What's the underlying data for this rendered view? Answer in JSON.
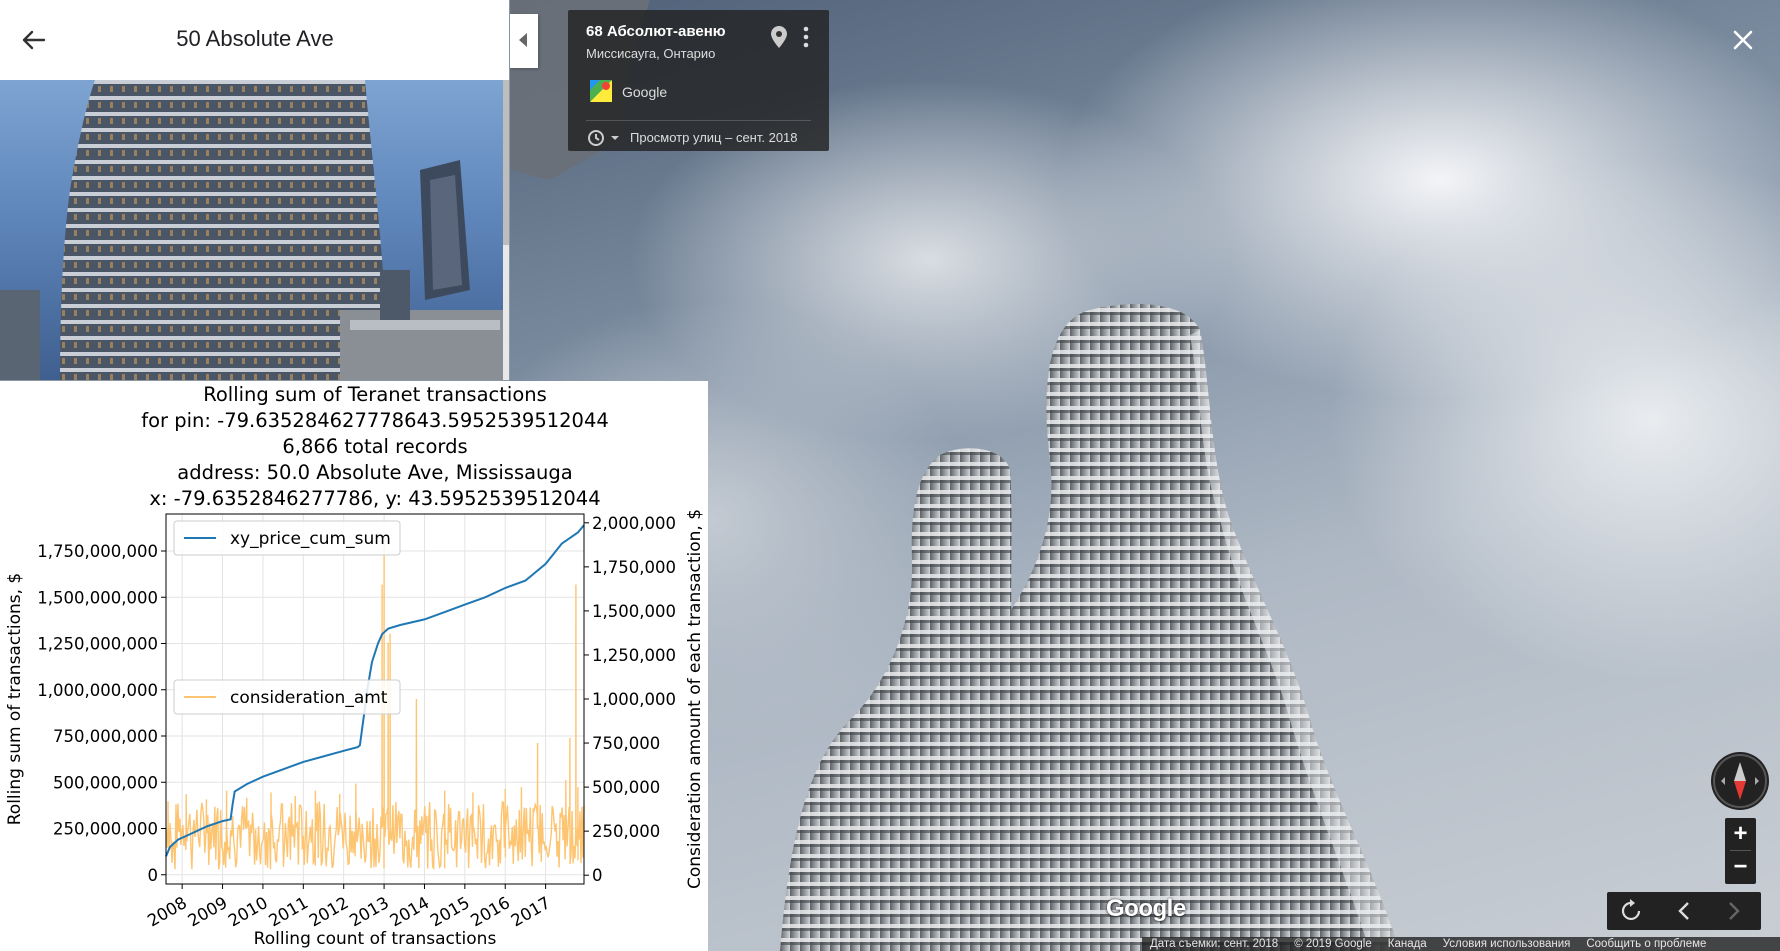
{
  "panel": {
    "title": "50 Absolute Ave"
  },
  "info_card": {
    "title": "68 Абсолют-авеню",
    "subtitle": "Миссисауга, Онтарио",
    "source": "Google",
    "date": "Просмотр улиц – сент. 2018"
  },
  "street_view": {
    "logo": "Google",
    "zoom_in": "+",
    "zoom_out": "−",
    "icons": [
      "back-arrow-icon",
      "pin-icon",
      "more-vert-icon",
      "close-icon",
      "history-icon",
      "compass-icon",
      "rotate-icon",
      "chevron-left-icon",
      "chevron-right-icon"
    ]
  },
  "footer": {
    "capture_date": "Дата съемки: сент. 2018",
    "copyright": "© 2019 Google",
    "country": "Канада",
    "terms": "Условия использования",
    "report": "Сообщить о проблеме"
  },
  "chart_data": {
    "type": "line",
    "title_lines": [
      "Rolling sum of Teranet transactions",
      "for pin: -79.635284627778643.5952539512044",
      "6,866 total records",
      "address: 50.0 Absolute Ave, Mississauga",
      "x: -79.6352846277786, y: 43.5952539512044"
    ],
    "xlabel": "Rolling count of transactions",
    "ylabel_left": "Rolling sum of transactions, $",
    "ylabel_right": "Consideration amount of each transaction, $",
    "x_tick_labels": [
      "2008",
      "2009",
      "2010",
      "2011",
      "2012",
      "2013",
      "2014",
      "2015",
      "2016",
      "2017"
    ],
    "x_range": [
      2007.6,
      2017.95
    ],
    "y_left_ticks": [
      "0",
      "250,000,000",
      "500,000,000",
      "750,000,000",
      "1,000,000,000",
      "1,250,000,000",
      "1,500,000,000",
      "1,750,000,000"
    ],
    "y_left_range": [
      -50000000,
      1950000000
    ],
    "y_right_ticks": [
      "0",
      "250,000",
      "500,000",
      "750,000",
      "1,000,000",
      "1,250,000",
      "1,500,000",
      "1,750,000",
      "2,000,000"
    ],
    "y_right_range": [
      -50000,
      2050000
    ],
    "grid": true,
    "series": [
      {
        "name": "xy_price_cum_sum",
        "axis": "left",
        "color": "#1f77b4",
        "legend_position": "upper-left",
        "points": [
          [
            2007.6,
            100000000
          ],
          [
            2007.7,
            150000000
          ],
          [
            2007.9,
            190000000
          ],
          [
            2008.2,
            220000000
          ],
          [
            2008.6,
            260000000
          ],
          [
            2009.0,
            290000000
          ],
          [
            2009.2,
            300000000
          ],
          [
            2009.25,
            380000000
          ],
          [
            2009.3,
            450000000
          ],
          [
            2009.6,
            490000000
          ],
          [
            2010.0,
            530000000
          ],
          [
            2010.5,
            570000000
          ],
          [
            2011.0,
            610000000
          ],
          [
            2011.5,
            640000000
          ],
          [
            2012.0,
            670000000
          ],
          [
            2012.35,
            690000000
          ],
          [
            2012.4,
            700000000
          ],
          [
            2012.5,
            860000000
          ],
          [
            2012.6,
            1020000000
          ],
          [
            2012.7,
            1150000000
          ],
          [
            2012.85,
            1250000000
          ],
          [
            2012.95,
            1300000000
          ],
          [
            2013.1,
            1330000000
          ],
          [
            2013.4,
            1350000000
          ],
          [
            2014.0,
            1380000000
          ],
          [
            2014.5,
            1420000000
          ],
          [
            2015.0,
            1460000000
          ],
          [
            2015.5,
            1500000000
          ],
          [
            2016.0,
            1550000000
          ],
          [
            2016.5,
            1590000000
          ],
          [
            2017.0,
            1680000000
          ],
          [
            2017.4,
            1790000000
          ],
          [
            2017.8,
            1850000000
          ],
          [
            2017.95,
            1890000000
          ]
        ]
      },
      {
        "name": "consideration_amt",
        "axis": "right",
        "color": "#fdc572",
        "legend_position": "center-left",
        "baseline": 270000,
        "spikes": [
          [
            2007.65,
            420000
          ],
          [
            2008.1,
            460000
          ],
          [
            2008.6,
            430000
          ],
          [
            2009.1,
            480000
          ],
          [
            2009.6,
            440000
          ],
          [
            2010.2,
            470000
          ],
          [
            2010.8,
            450000
          ],
          [
            2011.3,
            480000
          ],
          [
            2011.9,
            460000
          ],
          [
            2012.3,
            520000
          ],
          [
            2012.95,
            1650000
          ],
          [
            2013.0,
            1900000
          ],
          [
            2013.1,
            1320000
          ],
          [
            2013.15,
            1370000
          ],
          [
            2013.8,
            1000000
          ],
          [
            2014.5,
            480000
          ],
          [
            2015.2,
            470000
          ],
          [
            2016.0,
            490000
          ],
          [
            2016.4,
            500000
          ],
          [
            2016.8,
            750000
          ],
          [
            2017.5,
            540000
          ],
          [
            2017.6,
            780000
          ],
          [
            2017.75,
            1650000
          ],
          [
            2017.8,
            500000
          ]
        ]
      }
    ]
  }
}
